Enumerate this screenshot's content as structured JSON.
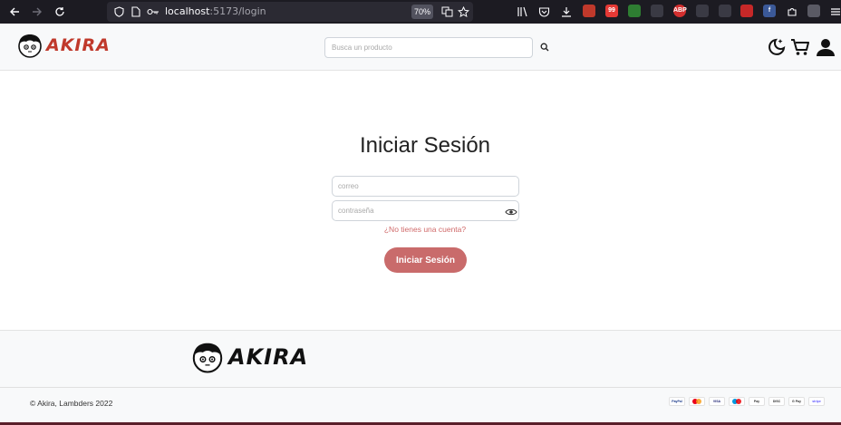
{
  "browser": {
    "url_host": "localhost",
    "url_rest": ":5173/login",
    "zoom": "70%",
    "icons": [
      "back-icon",
      "forward-icon",
      "reload-icon",
      "shield-icon",
      "page-icon",
      "key-icon",
      "translate-icon",
      "bookmark-star-icon",
      "library-icon",
      "pocket-icon",
      "download-icon",
      "extensions-icon",
      "menu-icon"
    ],
    "extensions": [
      {
        "name": "extension-red-icon",
        "label": "",
        "color": "#c0392b"
      },
      {
        "name": "extension-yt-icon",
        "label": "99",
        "color": "#e53935"
      },
      {
        "name": "extension-green-download-icon",
        "label": "",
        "color": "#2e7d32"
      },
      {
        "name": "extension-screenshot-icon",
        "label": "",
        "color": "#3a3a44"
      },
      {
        "name": "extension-abp-icon",
        "label": "ABP",
        "color": "#d32f2f"
      },
      {
        "name": "extension-eyes-icon",
        "label": "",
        "color": "#3a3a44"
      },
      {
        "name": "extension-arrow-icon",
        "label": "",
        "color": "#3a3a44"
      },
      {
        "name": "extension-flash-icon",
        "label": "",
        "color": "#c62828"
      },
      {
        "name": "extension-facebook-icon",
        "label": "f",
        "color": "#3b5998"
      },
      {
        "name": "extension-puzzle-icon",
        "label": "",
        "color": "#3a3a44"
      },
      {
        "name": "extension-grey-icon",
        "label": "",
        "color": "#5a5a64"
      }
    ]
  },
  "header": {
    "logo_text": "AKIRA",
    "search": {
      "placeholder": "Busca un producto",
      "value": ""
    },
    "icons": [
      "theme-toggle-icon",
      "cart-icon",
      "user-icon"
    ]
  },
  "login": {
    "title": "Iniciar Sesión",
    "email_placeholder": "correo",
    "password_placeholder": "contraseña",
    "register_link": "¿No tienes una cuenta?",
    "submit_label": "Iniciar Sesión"
  },
  "footer": {
    "logo_text": "AKIRA",
    "copyright": "© Akira, Lambders 2022",
    "payments": [
      "PayPal",
      "MC",
      "VISA",
      "MC",
      "Pay",
      "DISC",
      "G Pay",
      "stripe"
    ]
  },
  "colors": {
    "accent": "#c96b6b",
    "link": "#d06a6a",
    "logo_red": "#c0392b",
    "browser_chrome": "#1c1b22"
  }
}
